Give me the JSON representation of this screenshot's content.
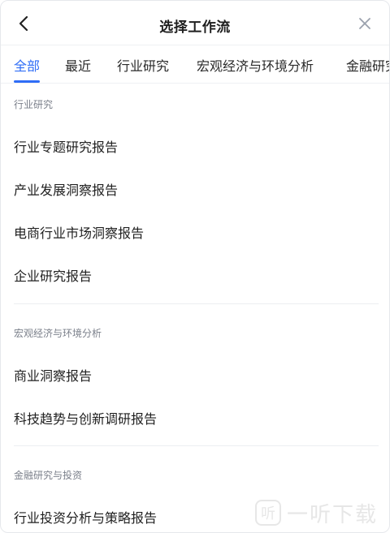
{
  "header": {
    "title": "选择工作流"
  },
  "tabs": [
    {
      "label": "全部",
      "active": true
    },
    {
      "label": "最近"
    },
    {
      "label": "行业研究"
    },
    {
      "label": "宏观经济与环境分析"
    },
    {
      "label": "金融研究"
    }
  ],
  "sections": [
    {
      "title": "行业研究",
      "items": [
        "行业专题研究报告",
        "产业发展洞察报告",
        "电商行业市场洞察报告",
        "企业研究报告"
      ]
    },
    {
      "title": "宏观经济与环境分析",
      "items": [
        "商业洞察报告",
        "科技趋势与创新调研报告"
      ]
    },
    {
      "title": "金融研究与投资",
      "items": [
        "行业投资分析与策略报告"
      ]
    }
  ],
  "watermark": {
    "text": "一听下载"
  },
  "colors": {
    "accent": "#2f6df6",
    "section_title": "#7a7f8a"
  }
}
